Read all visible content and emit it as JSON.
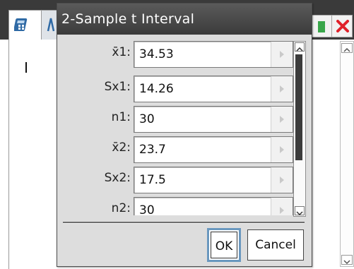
{
  "dialog": {
    "title": "2-Sample t Interval",
    "fields": [
      {
        "label": "x̄1:",
        "value": "34.53"
      },
      {
        "label": "Sx1:",
        "value": "14.26"
      },
      {
        "label": "n1:",
        "value": "30"
      },
      {
        "label": "x̄2:",
        "value": "23.7"
      },
      {
        "label": "Sx2:",
        "value": "17.5"
      },
      {
        "label": "n2:",
        "value": "30"
      }
    ],
    "ok_label": "OK",
    "cancel_label": "Cancel"
  },
  "icons": {
    "tab1": "calculator-icon",
    "tab2": "lists-icon",
    "restore": "restore-window-icon",
    "close": "close-icon",
    "field_arrow": "arrow-right-icon",
    "scroll_up": "scroll-up-icon",
    "scroll_down": "scroll-down-icon"
  },
  "colors": {
    "title_bar": "#3b3b3b",
    "dialog_bg": "#dcdcdc",
    "ok_focus": "#6a98bf",
    "close_x": "#e0212a",
    "restore": "#39a64a"
  }
}
